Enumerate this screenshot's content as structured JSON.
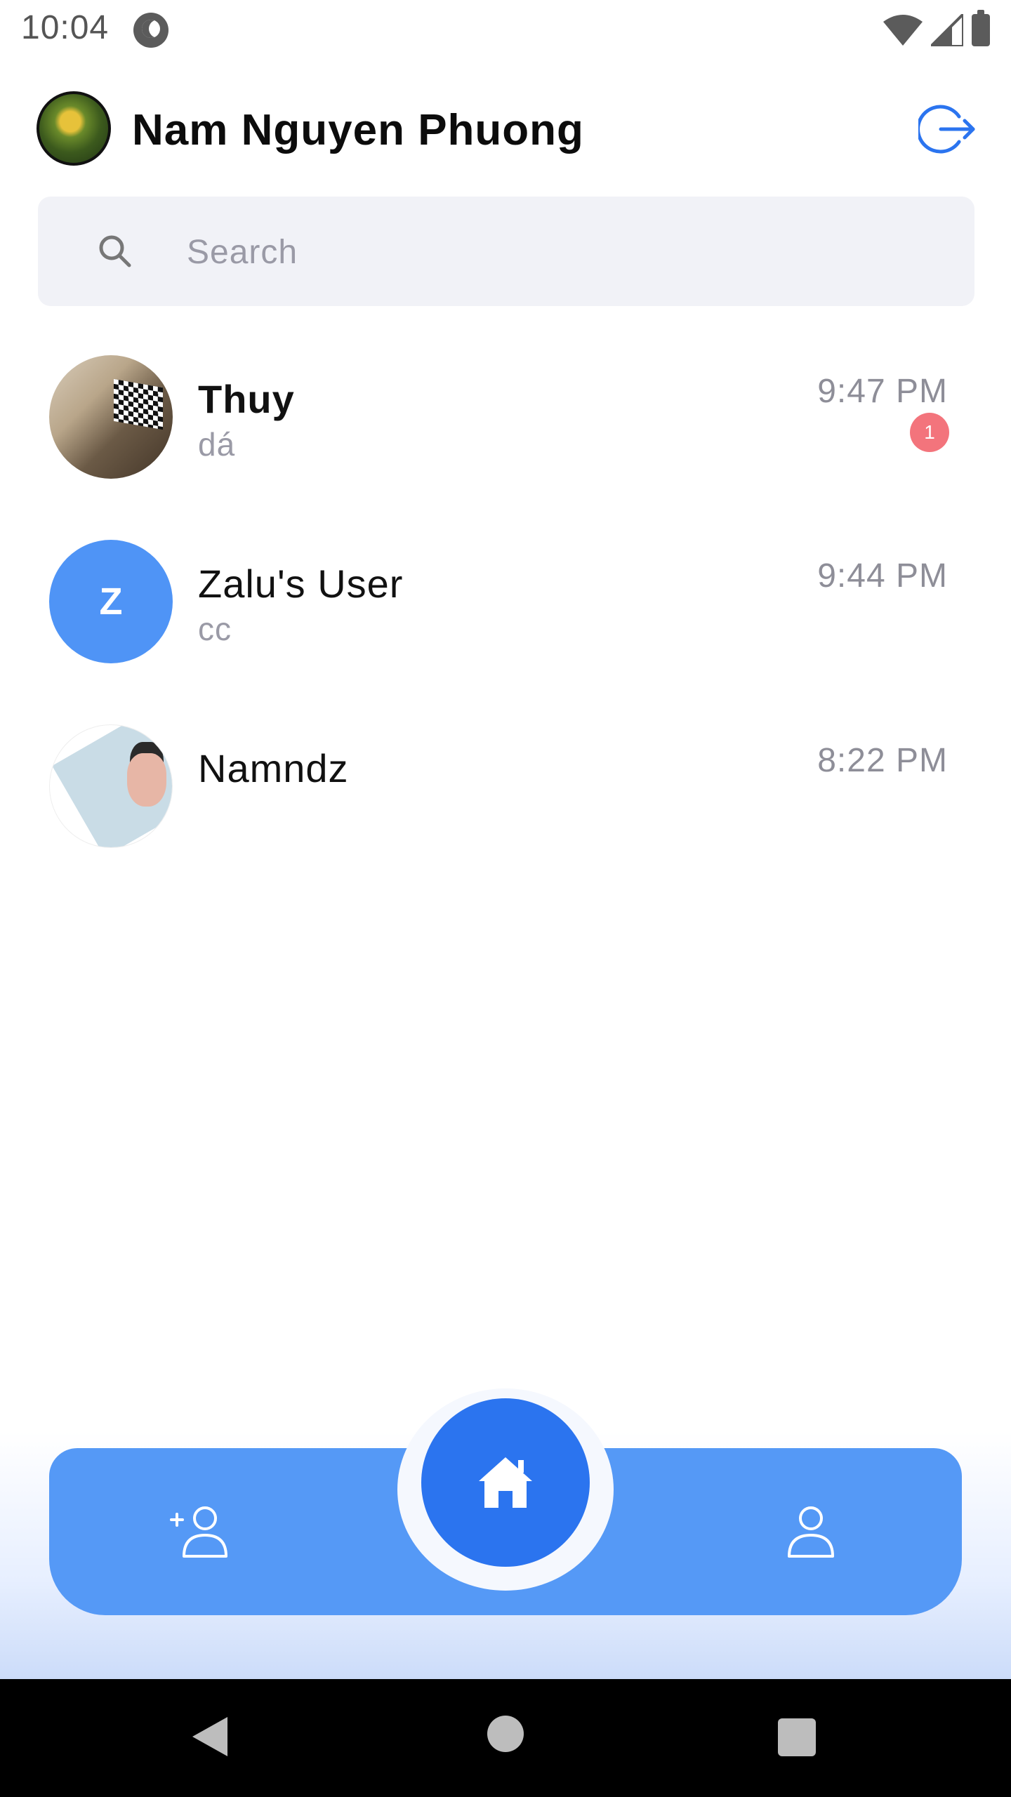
{
  "status_bar": {
    "time": "10:04"
  },
  "header": {
    "user_name": "Nam Nguyen Phuong"
  },
  "search": {
    "placeholder": "Search"
  },
  "conversations": [
    {
      "name": "Thuy",
      "preview": "dá",
      "time": "9:47 PM",
      "unread": "1",
      "bold": true
    },
    {
      "name": "Zalu's User",
      "preview": "cc",
      "time": "9:44 PM",
      "avatar_letter": "Z"
    },
    {
      "name": "Namndz",
      "preview": "",
      "time": "8:22 PM"
    }
  ],
  "colors": {
    "accent": "#5599f6",
    "accent_dark": "#2b74ef",
    "badge": "#f3747c",
    "search_bg": "#f1f2f7"
  },
  "nav": {
    "left_icon": "add-friend-icon",
    "center_icon": "home-icon",
    "right_icon": "profile-icon"
  }
}
